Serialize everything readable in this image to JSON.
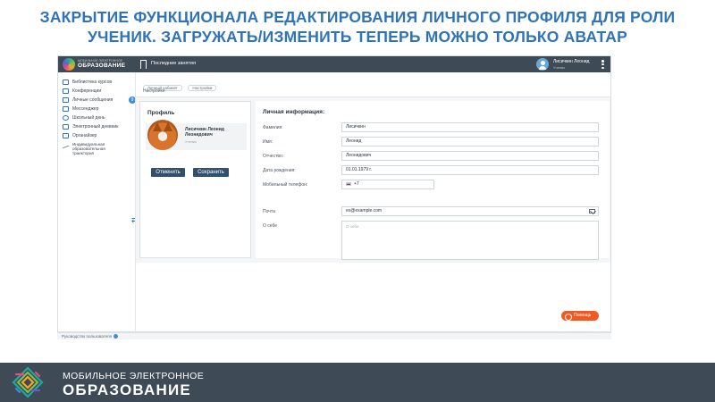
{
  "slide": {
    "title_line1": "ЗАКРЫТИЕ ФУНКЦИОНАЛА РЕДАКТИРОВАНИЯ ЛИЧНОГО ПРОФИЛЯ ДЛЯ РОЛИ",
    "title_line2": "УЧЕНИК. ЗАГРУЖАТЬ/ИЗМЕНИТЬ ТЕПЕРЬ МОЖНО ТОЛЬКО АВАТАР"
  },
  "topbar": {
    "logo_top": "МОБИЛЬНОЕ ЭЛЕКТРОННОЕ",
    "logo_main": "ОБРАЗОВАНИЕ",
    "last_label": "Последние занятия",
    "user_name": "Лисичкин Леонид",
    "user_role": "Ученик"
  },
  "sidebar": {
    "items": [
      {
        "label": "Библиотека курсов",
        "icon": "library-icon"
      },
      {
        "label": "Конференции",
        "icon": "conference-icon"
      },
      {
        "label": "Личные сообщения",
        "icon": "messages-icon",
        "badge": "9"
      },
      {
        "label": "Мессенджер",
        "icon": "messenger-icon"
      },
      {
        "label": "Школьный день",
        "icon": "clock-icon"
      },
      {
        "label": "Электронный дневник",
        "icon": "diary-icon"
      },
      {
        "label": "Органайзер",
        "icon": "calendar-icon"
      },
      {
        "label": "Индивидуальная образовательная траектория",
        "icon": "trajectory-icon"
      }
    ]
  },
  "content": {
    "crumbs": [
      "Личный кабинет",
      "Настройки"
    ],
    "page_sub": "Настройки"
  },
  "profile": {
    "title": "Профиль",
    "name_line1": "Лисичкин Леонид",
    "name_line2": "Леонидович",
    "role": "Ученик",
    "cancel_label": "Отменить",
    "save_label": "Сохранить"
  },
  "form": {
    "title": "Личная информация:",
    "fields": [
      {
        "label": "Фамилия:",
        "value": "Лисичкин"
      },
      {
        "label": "Имя:",
        "value": "Леонид"
      },
      {
        "label": "Отчество:",
        "value": "Леонидович"
      },
      {
        "label": "Дата рождения:",
        "value": "01.01.1979 г."
      },
      {
        "label": "Мобильный телефон:",
        "value": "+7"
      },
      {
        "label": "Почта",
        "value": "ex@example.com"
      }
    ],
    "about_label": "О себе",
    "about_placeholder": "О себе"
  },
  "help_label": "Помощь",
  "footer": {
    "text": "Руководство пользователя"
  },
  "banner": {
    "top": "МОБИЛЬНОЕ ЭЛЕКТРОННОЕ",
    "main": "ОБРАЗОВАНИЕ"
  }
}
